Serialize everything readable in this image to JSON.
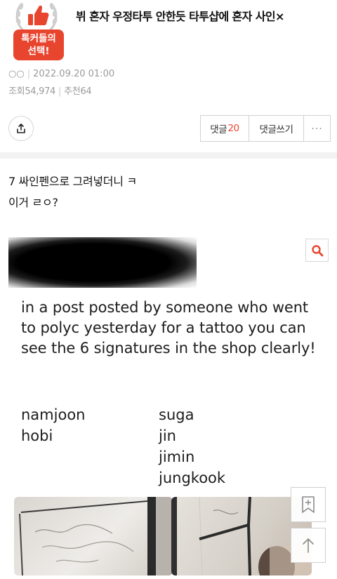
{
  "header": {
    "badge_line1": "톡커들의",
    "badge_line2": "선택!",
    "title": "뷔 혼자 우정타투 안한듯 타투샵에 혼자 사인×"
  },
  "meta": {
    "author": "○○",
    "date": "2022.09.20 01:00",
    "views_label": "조회",
    "views": "54,974",
    "recommend_label": "추천",
    "recommend": "64"
  },
  "actions": {
    "comments_label": "댓글",
    "comments_count": "20",
    "write_label": "댓글쓰기",
    "more_label": "..."
  },
  "post": {
    "line1": "7 싸인펜으로 그려넣더니 ㅋ",
    "line2": "이거 ㄹㅇ?",
    "embed_text": "in a post posted by someone who went to polyc yesterday for a tattoo you can see the 6 signatures in the shop clearly!",
    "names_left": [
      "namjoon",
      "hobi"
    ],
    "names_right": [
      "suga",
      "jin",
      "jimin",
      "jungkook"
    ]
  },
  "colors": {
    "accent": "#e8452f",
    "meta": "#9a9a9a"
  },
  "icons": [
    "laurel-badge-icon",
    "thumbs-up-icon",
    "share-icon",
    "search-icon",
    "bookmark-icon",
    "arrow-up-icon"
  ]
}
